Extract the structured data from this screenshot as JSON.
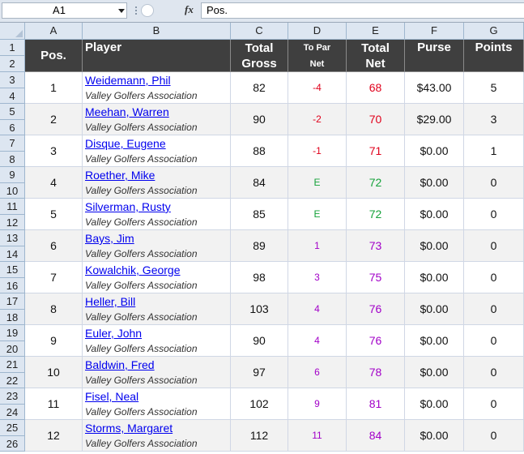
{
  "formula_bar": {
    "cell_ref": "A1",
    "fx": "fx",
    "content": "Pos."
  },
  "columns": [
    "A",
    "B",
    "C",
    "D",
    "E",
    "F",
    "G"
  ],
  "row_numbers": [
    "1",
    "2",
    "3",
    "4",
    "5",
    "6",
    "7",
    "8",
    "9",
    "10",
    "11",
    "12",
    "13",
    "14",
    "15",
    "16",
    "17",
    "18",
    "19",
    "20",
    "21",
    "22",
    "23",
    "24",
    "25",
    "26"
  ],
  "header": {
    "pos": "Pos.",
    "player": "Player",
    "total_gross": [
      "Total",
      "Gross"
    ],
    "to_par_net": [
      "To Par",
      "Net"
    ],
    "total_net": [
      "Total",
      "Net"
    ],
    "purse": "Purse",
    "points": "Points"
  },
  "colors": {
    "header_bg": "#3f3f3f",
    "under_par": "#e0001b",
    "even": "#15a23a",
    "over_par": "#a200c8",
    "link": "#0000ee"
  },
  "rows": [
    {
      "pos": "1",
      "name": "Weidemann, Phil",
      "assoc": "Valley Golfers Association",
      "gross": "82",
      "topar": "-4",
      "net": "68",
      "purse": "$43.00",
      "points": "5",
      "tone": "under"
    },
    {
      "pos": "2",
      "name": "Meehan, Warren",
      "assoc": "Valley Golfers Association",
      "gross": "90",
      "topar": "-2",
      "net": "70",
      "purse": "$29.00",
      "points": "3",
      "tone": "under"
    },
    {
      "pos": "3",
      "name": "Disque, Eugene",
      "assoc": "Valley Golfers Association",
      "gross": "88",
      "topar": "-1",
      "net": "71",
      "purse": "$0.00",
      "points": "1",
      "tone": "under"
    },
    {
      "pos": "4",
      "name": "Roether, Mike",
      "assoc": "Valley Golfers Association",
      "gross": "84",
      "topar": "E",
      "net": "72",
      "purse": "$0.00",
      "points": "0",
      "tone": "even"
    },
    {
      "pos": "5",
      "name": "Silverman, Rusty",
      "assoc": "Valley Golfers Association",
      "gross": "85",
      "topar": "E",
      "net": "72",
      "purse": "$0.00",
      "points": "0",
      "tone": "even"
    },
    {
      "pos": "6",
      "name": "Bays, Jim",
      "assoc": "Valley Golfers Association",
      "gross": "89",
      "topar": "1",
      "net": "73",
      "purse": "$0.00",
      "points": "0",
      "tone": "over"
    },
    {
      "pos": "7",
      "name": "Kowalchik, George",
      "assoc": "Valley Golfers Association",
      "gross": "98",
      "topar": "3",
      "net": "75",
      "purse": "$0.00",
      "points": "0",
      "tone": "over"
    },
    {
      "pos": "8",
      "name": "Heller, Bill",
      "assoc": "Valley Golfers Association",
      "gross": "103",
      "topar": "4",
      "net": "76",
      "purse": "$0.00",
      "points": "0",
      "tone": "over"
    },
    {
      "pos": "9",
      "name": "Euler, John",
      "assoc": "Valley Golfers Association",
      "gross": "90",
      "topar": "4",
      "net": "76",
      "purse": "$0.00",
      "points": "0",
      "tone": "over"
    },
    {
      "pos": "10",
      "name": "Baldwin, Fred",
      "assoc": "Valley Golfers Association",
      "gross": "97",
      "topar": "6",
      "net": "78",
      "purse": "$0.00",
      "points": "0",
      "tone": "over"
    },
    {
      "pos": "11",
      "name": "Fisel, Neal",
      "assoc": "Valley Golfers Association",
      "gross": "102",
      "topar": "9",
      "net": "81",
      "purse": "$0.00",
      "points": "0",
      "tone": "over"
    },
    {
      "pos": "12",
      "name": "Storms, Margaret",
      "assoc": "Valley Golfers Association",
      "gross": "112",
      "topar": "11",
      "net": "84",
      "purse": "$0.00",
      "points": "0",
      "tone": "over"
    }
  ]
}
